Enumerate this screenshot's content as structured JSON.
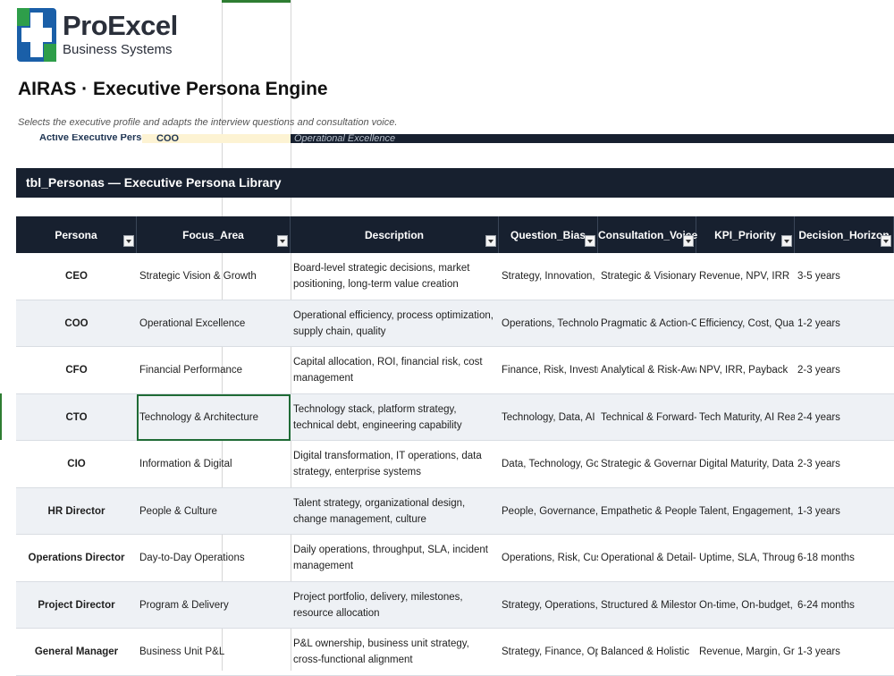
{
  "brand": {
    "name": "ProExcel",
    "sub": "Business Systems"
  },
  "page_title": "AIRAS · Executive Persona Engine",
  "subtitle": "Selects the executive profile and adapts the interview questions and consultation voice.",
  "persona_selector": {
    "label": "Active Executive Persona:",
    "value": "COO",
    "focus": "Operational Excellence"
  },
  "section_title": "tbl_Personas — Executive Persona Library",
  "columns": [
    "Persona",
    "Focus_Area",
    "Description",
    "Question_Bias",
    "Consultation_Voice",
    "KPI_Priority",
    "Decision_Horizon"
  ],
  "rows": [
    [
      "CEO",
      "Strategic Vision & Growth",
      "Board-level strategic decisions, market positioning, long-term value creation",
      "Strategy, Innovation, Mark",
      "Strategic & Visionary",
      "Revenue, NPV, IRR",
      "3-5 years"
    ],
    [
      "COO",
      "Operational Excellence",
      "Operational efficiency, process optimization, supply chain, quality",
      "Operations, Technology, F",
      "Pragmatic & Action-Orien",
      "Efficiency, Cost, Quality",
      "1-2 years"
    ],
    [
      "CFO",
      "Financial Performance",
      "Capital allocation, ROI, financial risk, cost management",
      "Finance, Risk, Investment",
      "Analytical & Risk-Aware",
      "NPV, IRR, Payback",
      "2-3 years"
    ],
    [
      "CTO",
      "Technology & Architecture",
      "Technology stack, platform strategy, technical debt, engineering capability",
      "Technology, Data, AI",
      "Technical & Forward-Look",
      "Tech Maturity, AI Readine",
      "2-4 years"
    ],
    [
      "CIO",
      "Information & Digital",
      "Digital transformation, IT operations, data strategy, enterprise systems",
      "Data, Technology, Govern",
      "Strategic & Governance-Fo",
      "Digital Maturity, Data Qu",
      "2-3 years"
    ],
    [
      "HR Director",
      "People & Culture",
      "Talent strategy, organizational design, change management, culture",
      "People, Governance, Cultu",
      "Empathetic & People-Cent",
      "Talent, Engagement, Chan",
      "1-3 years"
    ],
    [
      "Operations Director",
      "Day-to-Day Operations",
      "Daily operations, throughput, SLA, incident management",
      "Operations, Risk, Custome",
      "Operational & Detail-Focu",
      "Uptime, SLA, Throughput",
      "6-18 months"
    ],
    [
      "Project Director",
      "Program & Delivery",
      "Project portfolio, delivery, milestones, resource allocation",
      "Strategy, Operations, Fina",
      "Structured & Milestone-Di",
      "On-time, On-budget, Scop",
      "6-24 months"
    ],
    [
      "General Manager",
      "Business Unit P&L",
      "P&L ownership, business unit strategy, cross-functional alignment",
      "Strategy, Finance, Operati",
      "Balanced & Holistic",
      "Revenue, Margin, Growth",
      "1-3 years"
    ]
  ],
  "colors": {
    "header_bg": "#17202f",
    "accent_green": "#2e7d32",
    "logo_blue": "#1a5fa8",
    "logo_green": "#2e9e4a"
  }
}
